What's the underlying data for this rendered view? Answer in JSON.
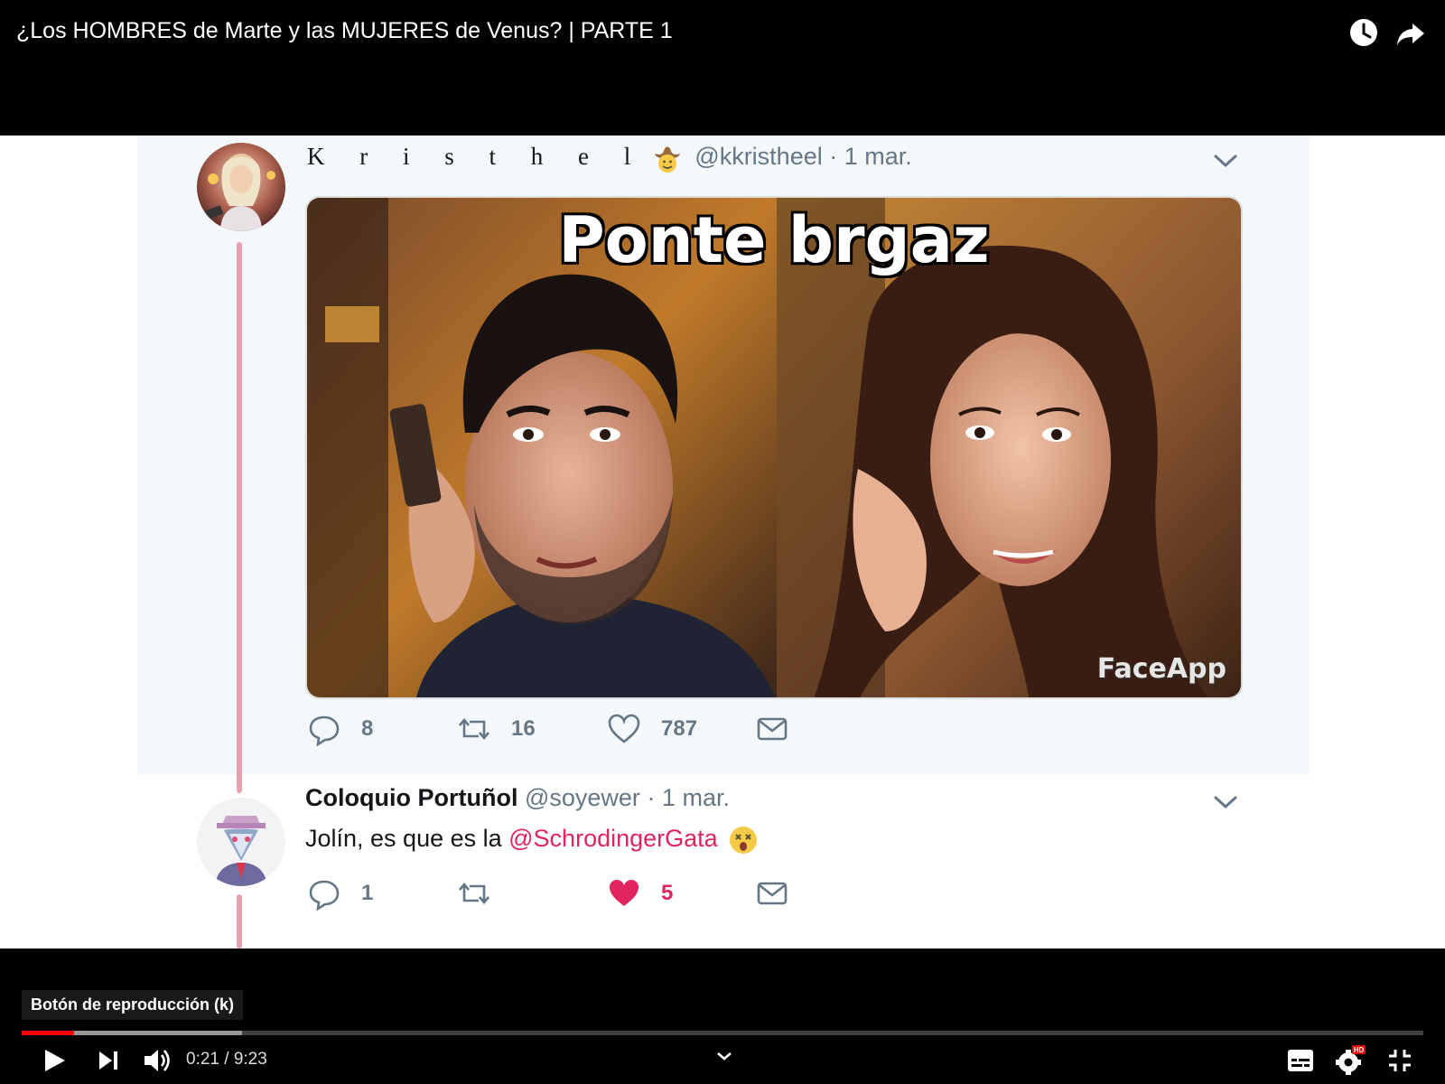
{
  "player": {
    "title": "¿Los HOMBRES de Marte y las MUJERES de Venus? | PARTE 1",
    "tooltip": "Botón de reproducción (k)",
    "current_time": "0:21",
    "separator": "/",
    "duration": "9:23",
    "progress_played": 0.0373,
    "progress_buffered": 0.157,
    "accent_color": "#ff0000",
    "top_icons": [
      "clock-icon",
      "share-icon"
    ],
    "controls": [
      "play-icon",
      "next-icon",
      "volume-icon",
      "chevron-down-icon",
      "subtitles-icon",
      "settings-icon",
      "exit-fullscreen-icon"
    ],
    "hd_badge": "HD"
  },
  "tweets": [
    {
      "display_name": "K r i s t h e l",
      "emoji": "cowboy-face-icon",
      "handle": "@kkristheel",
      "date": "· 1 mar.",
      "image_caption": "Ponte brgaz",
      "image_watermark": "FaceApp",
      "replies": "8",
      "retweets": "16",
      "likes": "787"
    },
    {
      "display_name": "Coloquio Portuñol",
      "handle": "@soyewer",
      "date": "· 1 mar.",
      "text_prefix": "Jolín, es que es la ",
      "mention": "@SchrodingerGata",
      "emoji": "astonished-face-icon",
      "replies": "1",
      "retweets": "",
      "likes": "5",
      "liked_color": "#e0245e"
    }
  ]
}
